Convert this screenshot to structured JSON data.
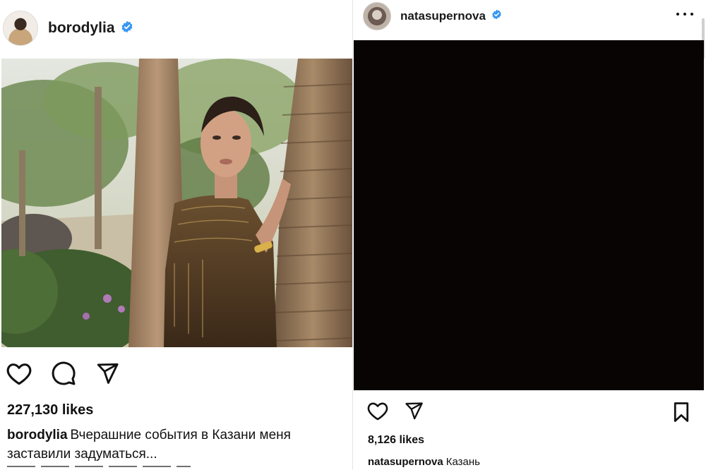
{
  "left_post": {
    "username": "borodylia",
    "verified_icon": "verified-badge-icon",
    "likes": "227,130 likes",
    "caption_user": "borodylia",
    "caption_text": "Вчерашние события в Казани меня заставили задуматься...",
    "actions": [
      "like-icon",
      "comment-icon",
      "share-icon"
    ]
  },
  "right_post": {
    "username": "natasupernova",
    "verified_icon": "verified-badge-icon",
    "likes": "8,126 likes",
    "caption_user": "natasupernova",
    "caption_text": "Казань",
    "actions": [
      "like-icon",
      "share-icon",
      "bookmark-icon",
      "more-options-icon"
    ]
  },
  "colors": {
    "verified": "#3897f0",
    "text": "#111111",
    "black_post": "#080403"
  }
}
